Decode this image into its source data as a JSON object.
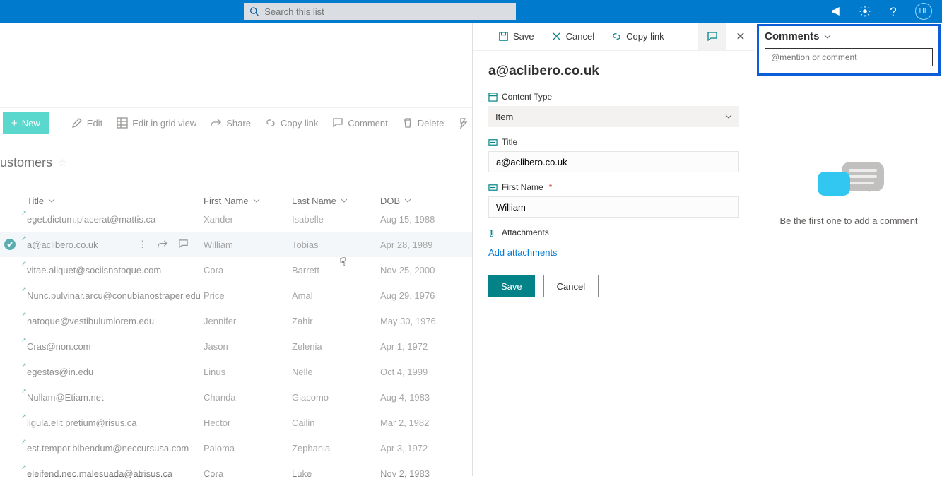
{
  "suite": {
    "search_placeholder": "Search this list",
    "avatar_initials": "HL"
  },
  "commands": {
    "new": "New",
    "edit": "Edit",
    "grid": "Edit in grid view",
    "share": "Share",
    "copy": "Copy link",
    "comment": "Comment",
    "delete": "Delete",
    "automate": "Automate"
  },
  "list_title": "ustomers",
  "columns": {
    "title": "Title",
    "first_name": "First Name",
    "last_name": "Last Name",
    "dob": "DOB"
  },
  "rows": [
    {
      "title": "eget.dictum.placerat@mattis.ca",
      "first": "Xander",
      "last": "Isabelle",
      "dob": "Aug 15, 1988",
      "selected": false
    },
    {
      "title": "a@aclibero.co.uk",
      "first": "William",
      "last": "Tobias",
      "dob": "Apr 28, 1989",
      "selected": true
    },
    {
      "title": "vitae.aliquet@sociisnatoque.com",
      "first": "Cora",
      "last": "Barrett",
      "dob": "Nov 25, 2000",
      "selected": false
    },
    {
      "title": "Nunc.pulvinar.arcu@conubianostraper.edu",
      "first": "Price",
      "last": "Amal",
      "dob": "Aug 29, 1976",
      "selected": false
    },
    {
      "title": "natoque@vestibulumlorem.edu",
      "first": "Jennifer",
      "last": "Zahir",
      "dob": "May 30, 1976",
      "selected": false
    },
    {
      "title": "Cras@non.com",
      "first": "Jason",
      "last": "Zelenia",
      "dob": "Apr 1, 1972",
      "selected": false
    },
    {
      "title": "egestas@in.edu",
      "first": "Linus",
      "last": "Nelle",
      "dob": "Oct 4, 1999",
      "selected": false
    },
    {
      "title": "Nullam@Etiam.net",
      "first": "Chanda",
      "last": "Giacomo",
      "dob": "Aug 4, 1983",
      "selected": false
    },
    {
      "title": "ligula.elit.pretium@risus.ca",
      "first": "Hector",
      "last": "Cailin",
      "dob": "Mar 2, 1982",
      "selected": false
    },
    {
      "title": "est.tempor.bibendum@neccursusa.com",
      "first": "Paloma",
      "last": "Zephania",
      "dob": "Apr 3, 1972",
      "selected": false
    },
    {
      "title": "eleifend.nec.malesuada@atrisus.ca",
      "first": "Cora",
      "last": "Luke",
      "dob": "Nov 2, 1983",
      "selected": false
    }
  ],
  "panel": {
    "save": "Save",
    "cancel": "Cancel",
    "copy_link": "Copy link",
    "item_title": "a@aclibero.co.uk",
    "labels": {
      "content_type": "Content Type",
      "title": "Title",
      "first_name": "First Name",
      "attachments": "Attachments"
    },
    "values": {
      "content_type": "Item",
      "title": "a@aclibero.co.uk",
      "first_name": "William"
    },
    "add_attachments": "Add attachments",
    "save_btn": "Save",
    "cancel_btn": "Cancel"
  },
  "comments": {
    "heading": "Comments",
    "placeholder": "@mention or comment",
    "empty": "Be the first one to add a comment"
  }
}
